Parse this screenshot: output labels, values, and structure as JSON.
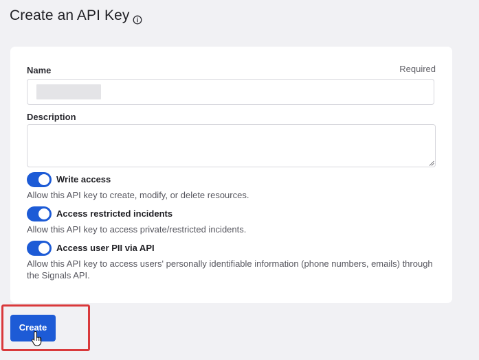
{
  "page": {
    "title": "Create an API Key",
    "title_icon": "info-icon"
  },
  "form": {
    "name_label": "Name",
    "name_required": "Required",
    "name_value": "",
    "description_label": "Description",
    "description_value": ""
  },
  "toggles": [
    {
      "title": "Write access",
      "description": "Allow this API key to create, modify, or delete resources.",
      "on": true
    },
    {
      "title": "Access restricted incidents",
      "description": "Allow this API key to access private/restricted incidents.",
      "on": true
    },
    {
      "title": "Access user PII via API",
      "description": "Allow this API key to access users' personally identifiable information (phone numbers, emails) through the Signals API.",
      "on": true
    }
  ],
  "actions": {
    "create_label": "Create"
  },
  "colors": {
    "accent": "#1d5bd6",
    "highlight": "#d9393b",
    "background": "#f1f1f4",
    "card": "#ffffff"
  },
  "annotations": {
    "highlight_target": "create-button",
    "cursor_icon": "hand-pointer-icon"
  }
}
